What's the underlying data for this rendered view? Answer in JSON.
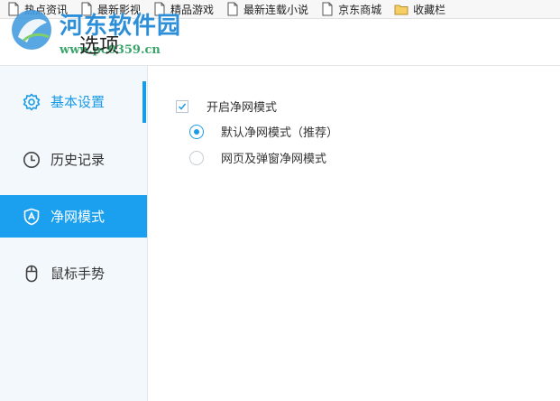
{
  "bookmarks": [
    {
      "label": "热点资讯",
      "icon": "doc-icon"
    },
    {
      "label": "最新影视",
      "icon": "doc-icon"
    },
    {
      "label": "精品游戏",
      "icon": "doc-icon"
    },
    {
      "label": "最新连载小说",
      "icon": "doc-icon"
    },
    {
      "label": "京东商城",
      "icon": "doc-icon"
    },
    {
      "label": "收藏栏",
      "icon": "folder-icon"
    }
  ],
  "watermark": {
    "title": "河东软件园",
    "url": "www.pc0359.cn"
  },
  "header": {
    "title": "选项"
  },
  "sidebar": {
    "items": [
      {
        "label": "基本设置",
        "icon": "gear-icon",
        "state": "selected"
      },
      {
        "label": "历史记录",
        "icon": "clock-icon",
        "state": "normal"
      },
      {
        "label": "净网模式",
        "icon": "shield-icon",
        "state": "active"
      },
      {
        "label": "鼠标手势",
        "icon": "mouse-icon",
        "state": "normal"
      }
    ]
  },
  "content": {
    "checkbox": {
      "label": "开启净网模式",
      "checked": true
    },
    "radios": [
      {
        "label": "默认净网模式（推荐）",
        "selected": true
      },
      {
        "label": "网页及弹窗净网模式",
        "selected": false
      }
    ]
  },
  "colors": {
    "accent": "#1a9be6",
    "active_bg": "#1aa0ef",
    "sidebar_bg": "#f3f8fd"
  }
}
